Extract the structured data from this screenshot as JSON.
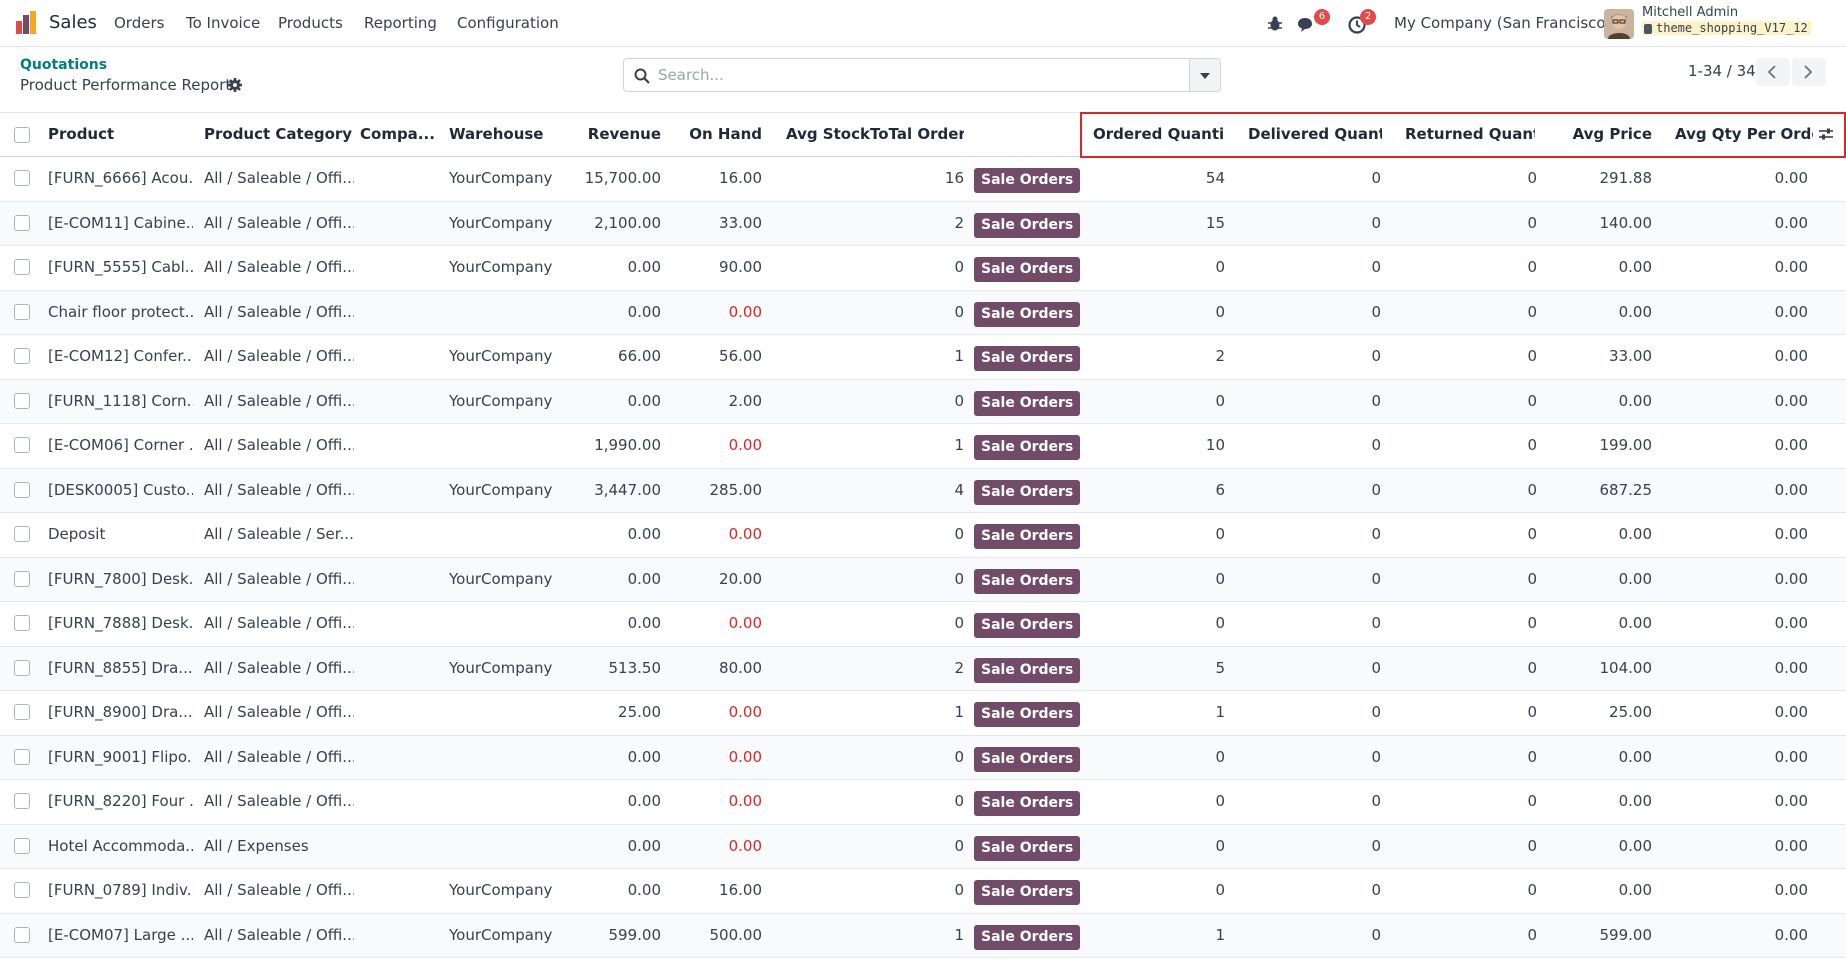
{
  "navbar": {
    "app_name": "Sales",
    "menus": [
      "Orders",
      "To Invoice",
      "Products",
      "Reporting",
      "Configuration"
    ],
    "messages_badge": "6",
    "activities_badge": "2",
    "company": "My Company (San Francisco)",
    "user_name": "Mitchell Admin",
    "database": "theme_shopping_V17_12",
    "brand_colors": [
      "#e54848",
      "#f5a623",
      "#714b67"
    ]
  },
  "control_panel": {
    "breadcrumb_parent": "Quotations",
    "breadcrumb_current": "Product Performance Report",
    "search_placeholder": "Search...",
    "pager": "1-34 / 34"
  },
  "table": {
    "columns": [
      "Product",
      "Product Category",
      "Compa...",
      "Warehouse",
      "Revenue",
      "On Hand",
      "Avg Stock",
      "ToTal Order",
      "Ordered Quanti...",
      "Delivered Quant...",
      "Returned Quant...",
      "Avg Price",
      "Avg Qty Per Order"
    ],
    "button_label": "Sale Orders",
    "highlight_color": "#dc2626",
    "rows": [
      {
        "product": "[FURN_6666] Acou...",
        "category": "All / Saleable / Offi...",
        "company": "",
        "warehouse": "YourCompany",
        "revenue": "15,700.00",
        "on_hand": "16.00",
        "on_hand_negative": false,
        "avg_stock": "",
        "total_order": "16",
        "ordered": "54",
        "delivered": "0",
        "returned": "0",
        "avg_price": "291.88",
        "avg_qty": "0.00"
      },
      {
        "product": "[E-COM11] Cabine...",
        "category": "All / Saleable / Offi...",
        "company": "",
        "warehouse": "YourCompany",
        "revenue": "2,100.00",
        "on_hand": "33.00",
        "on_hand_negative": false,
        "avg_stock": "",
        "total_order": "2",
        "ordered": "15",
        "delivered": "0",
        "returned": "0",
        "avg_price": "140.00",
        "avg_qty": "0.00"
      },
      {
        "product": "[FURN_5555] Cabl...",
        "category": "All / Saleable / Offi...",
        "company": "",
        "warehouse": "YourCompany",
        "revenue": "0.00",
        "on_hand": "90.00",
        "on_hand_negative": false,
        "avg_stock": "",
        "total_order": "0",
        "ordered": "0",
        "delivered": "0",
        "returned": "0",
        "avg_price": "0.00",
        "avg_qty": "0.00"
      },
      {
        "product": "Chair floor protect...",
        "category": "All / Saleable / Offi...",
        "company": "",
        "warehouse": "",
        "revenue": "0.00",
        "on_hand": "0.00",
        "on_hand_negative": true,
        "avg_stock": "",
        "total_order": "0",
        "ordered": "0",
        "delivered": "0",
        "returned": "0",
        "avg_price": "0.00",
        "avg_qty": "0.00"
      },
      {
        "product": "[E-COM12] Confer...",
        "category": "All / Saleable / Offi...",
        "company": "",
        "warehouse": "YourCompany",
        "revenue": "66.00",
        "on_hand": "56.00",
        "on_hand_negative": false,
        "avg_stock": "",
        "total_order": "1",
        "ordered": "2",
        "delivered": "0",
        "returned": "0",
        "avg_price": "33.00",
        "avg_qty": "0.00"
      },
      {
        "product": "[FURN_1118] Corn...",
        "category": "All / Saleable / Offi...",
        "company": "",
        "warehouse": "YourCompany",
        "revenue": "0.00",
        "on_hand": "2.00",
        "on_hand_negative": false,
        "avg_stock": "",
        "total_order": "0",
        "ordered": "0",
        "delivered": "0",
        "returned": "0",
        "avg_price": "0.00",
        "avg_qty": "0.00"
      },
      {
        "product": "[E-COM06] Corner ...",
        "category": "All / Saleable / Offi...",
        "company": "",
        "warehouse": "",
        "revenue": "1,990.00",
        "on_hand": "0.00",
        "on_hand_negative": true,
        "avg_stock": "",
        "total_order": "1",
        "ordered": "10",
        "delivered": "0",
        "returned": "0",
        "avg_price": "199.00",
        "avg_qty": "0.00"
      },
      {
        "product": "[DESK0005] Custo...",
        "category": "All / Saleable / Offi...",
        "company": "",
        "warehouse": "YourCompany",
        "revenue": "3,447.00",
        "on_hand": "285.00",
        "on_hand_negative": false,
        "avg_stock": "",
        "total_order": "4",
        "ordered": "6",
        "delivered": "0",
        "returned": "0",
        "avg_price": "687.25",
        "avg_qty": "0.00"
      },
      {
        "product": "Deposit",
        "category": "All / Saleable / Ser...",
        "company": "",
        "warehouse": "",
        "revenue": "0.00",
        "on_hand": "0.00",
        "on_hand_negative": true,
        "avg_stock": "",
        "total_order": "0",
        "ordered": "0",
        "delivered": "0",
        "returned": "0",
        "avg_price": "0.00",
        "avg_qty": "0.00"
      },
      {
        "product": "[FURN_7800] Desk...",
        "category": "All / Saleable / Offi...",
        "company": "",
        "warehouse": "YourCompany",
        "revenue": "0.00",
        "on_hand": "20.00",
        "on_hand_negative": false,
        "avg_stock": "",
        "total_order": "0",
        "ordered": "0",
        "delivered": "0",
        "returned": "0",
        "avg_price": "0.00",
        "avg_qty": "0.00"
      },
      {
        "product": "[FURN_7888] Desk...",
        "category": "All / Saleable / Offi...",
        "company": "",
        "warehouse": "",
        "revenue": "0.00",
        "on_hand": "0.00",
        "on_hand_negative": true,
        "avg_stock": "",
        "total_order": "0",
        "ordered": "0",
        "delivered": "0",
        "returned": "0",
        "avg_price": "0.00",
        "avg_qty": "0.00"
      },
      {
        "product": "[FURN_8855] Dra...",
        "category": "All / Saleable / Offi...",
        "company": "",
        "warehouse": "YourCompany",
        "revenue": "513.50",
        "on_hand": "80.00",
        "on_hand_negative": false,
        "avg_stock": "",
        "total_order": "2",
        "ordered": "5",
        "delivered": "0",
        "returned": "0",
        "avg_price": "104.00",
        "avg_qty": "0.00"
      },
      {
        "product": "[FURN_8900] Dra...",
        "category": "All / Saleable / Offi...",
        "company": "",
        "warehouse": "",
        "revenue": "25.00",
        "on_hand": "0.00",
        "on_hand_negative": true,
        "avg_stock": "",
        "total_order": "1",
        "ordered": "1",
        "delivered": "0",
        "returned": "0",
        "avg_price": "25.00",
        "avg_qty": "0.00"
      },
      {
        "product": "[FURN_9001] Flipo...",
        "category": "All / Saleable / Offi...",
        "company": "",
        "warehouse": "",
        "revenue": "0.00",
        "on_hand": "0.00",
        "on_hand_negative": true,
        "avg_stock": "",
        "total_order": "0",
        "ordered": "0",
        "delivered": "0",
        "returned": "0",
        "avg_price": "0.00",
        "avg_qty": "0.00"
      },
      {
        "product": "[FURN_8220] Four ...",
        "category": "All / Saleable / Offi...",
        "company": "",
        "warehouse": "",
        "revenue": "0.00",
        "on_hand": "0.00",
        "on_hand_negative": true,
        "avg_stock": "",
        "total_order": "0",
        "ordered": "0",
        "delivered": "0",
        "returned": "0",
        "avg_price": "0.00",
        "avg_qty": "0.00"
      },
      {
        "product": "Hotel Accommoda...",
        "category": "All / Expenses",
        "company": "",
        "warehouse": "",
        "revenue": "0.00",
        "on_hand": "0.00",
        "on_hand_negative": true,
        "avg_stock": "",
        "total_order": "0",
        "ordered": "0",
        "delivered": "0",
        "returned": "0",
        "avg_price": "0.00",
        "avg_qty": "0.00"
      },
      {
        "product": "[FURN_0789] Indiv...",
        "category": "All / Saleable / Offi...",
        "company": "",
        "warehouse": "YourCompany",
        "revenue": "0.00",
        "on_hand": "16.00",
        "on_hand_negative": false,
        "avg_stock": "",
        "total_order": "0",
        "ordered": "0",
        "delivered": "0",
        "returned": "0",
        "avg_price": "0.00",
        "avg_qty": "0.00"
      },
      {
        "product": "[E-COM07] Large ...",
        "category": "All / Saleable / Offi...",
        "company": "",
        "warehouse": "YourCompany",
        "revenue": "599.00",
        "on_hand": "500.00",
        "on_hand_negative": false,
        "avg_stock": "",
        "total_order": "1",
        "ordered": "1",
        "delivered": "0",
        "returned": "0",
        "avg_price": "599.00",
        "avg_qty": "0.00"
      }
    ]
  }
}
